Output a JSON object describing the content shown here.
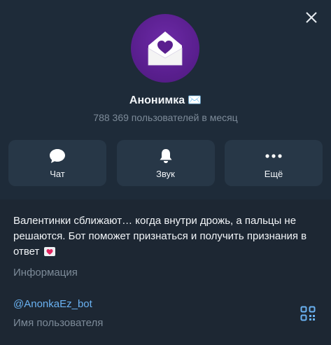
{
  "profile": {
    "name": "Анонимка",
    "name_emoji": "✉️",
    "subtitle": "788 369 пользователей в месяц"
  },
  "actions": [
    {
      "label": "Чат",
      "icon": "chat-bubble-icon"
    },
    {
      "label": "Звук",
      "icon": "bell-icon"
    },
    {
      "label": "Ещё",
      "icon": "more-dots-icon"
    }
  ],
  "info": {
    "description": "Валентинки сближают… когда внутри дрожь, а пальцы не решаются. Бот поможет признаться и получить признания в ответ",
    "description_caption": "Информация",
    "username": "@AnonkaEz_bot",
    "username_caption": "Имя пользователя"
  },
  "colors": {
    "accent": "#6ab2f2",
    "avatar": "#5a1f8f",
    "heart": "#5a1f8f",
    "background": "#1d2733"
  }
}
